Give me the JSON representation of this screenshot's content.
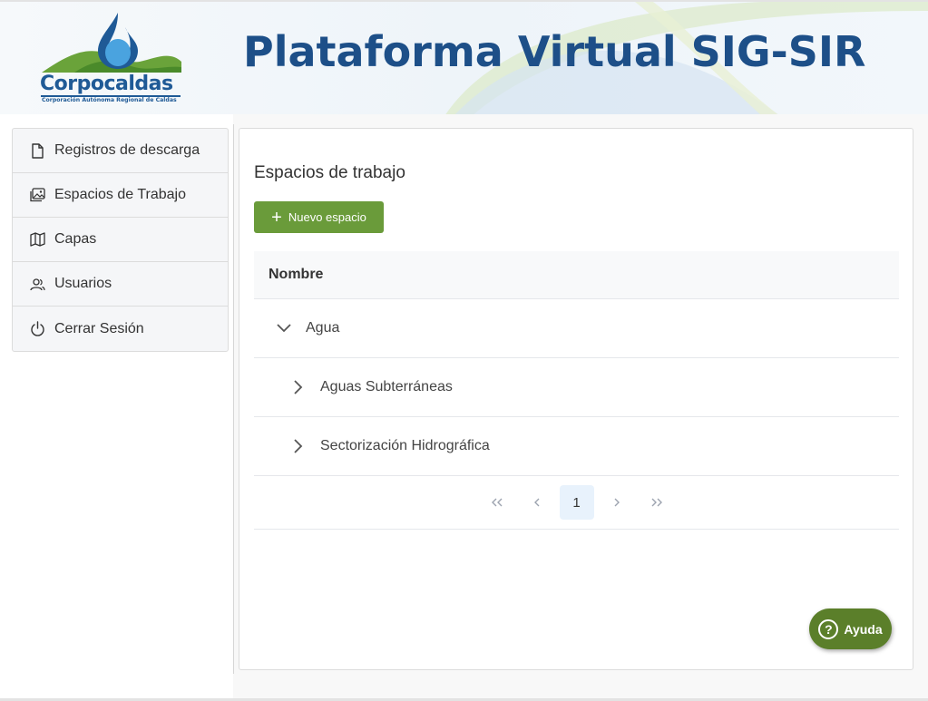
{
  "header": {
    "logo_name": "Corpocaldas",
    "logo_subtitle": "Corporación Autónoma Regional de Caldas",
    "title": "Plataforma Virtual SIG-SIR"
  },
  "sidebar": {
    "items": [
      {
        "label": "Registros de descarga",
        "icon": "file-icon"
      },
      {
        "label": "Espacios de Trabajo",
        "icon": "images-icon"
      },
      {
        "label": "Capas",
        "icon": "map-icon"
      },
      {
        "label": "Usuarios",
        "icon": "users-icon"
      },
      {
        "label": "Cerrar Sesión",
        "icon": "power-icon"
      }
    ]
  },
  "main": {
    "title": "Espacios de trabajo",
    "new_button": "Nuevo espacio",
    "table": {
      "header": "Nombre",
      "rows": [
        {
          "label": "Agua",
          "expanded": true,
          "level": 0
        },
        {
          "label": "Aguas Subterráneas",
          "expanded": false,
          "level": 1
        },
        {
          "label": "Sectorización Hidrográfica",
          "expanded": false,
          "level": 1
        }
      ]
    },
    "pagination": {
      "current_page": "1"
    }
  },
  "help": {
    "label": "Ayuda",
    "icon": "question-icon"
  },
  "colors": {
    "brand_blue": "#1d4f88",
    "primary_green": "#6a9b3a",
    "help_green": "#5b7f2a"
  }
}
